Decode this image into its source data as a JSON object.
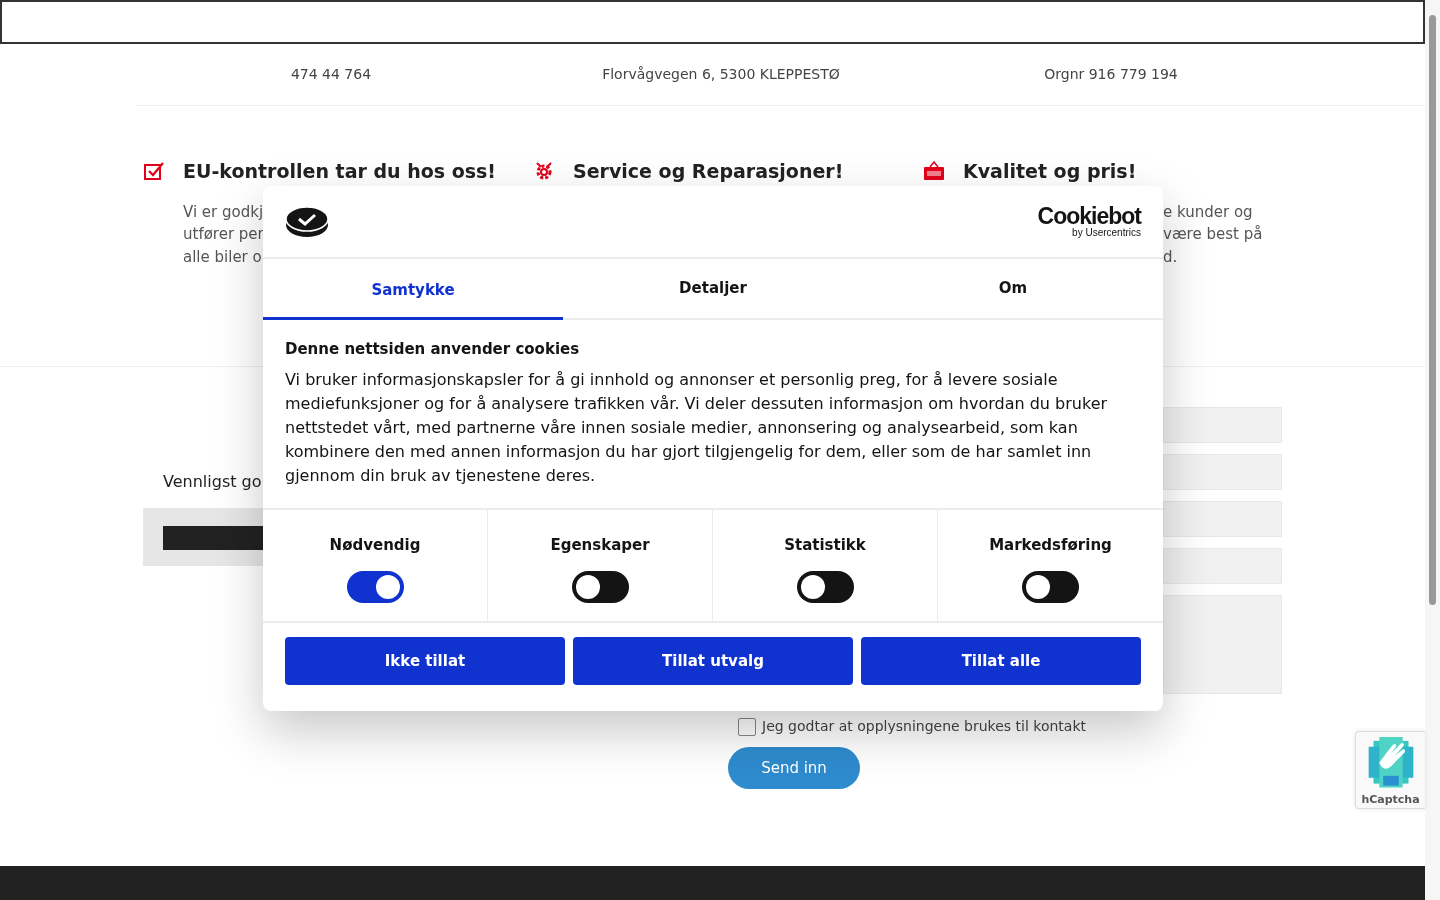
{
  "contact_bar": [
    "474 44 764",
    "Florvågvegen 6, 5300 KLEPPESTØ",
    "Orgnr 916 779 194"
  ],
  "features": [
    {
      "heading": "EU-kontrollen tar du hos oss!",
      "lines": [
        "Vi er godkj",
        "utfører per",
        "alle biler o"
      ]
    },
    {
      "heading": "Service og Reparasjoner!"
    },
    {
      "heading": "Kvalitet og pris!",
      "lines": [
        "e kunder og",
        "være best på",
        "d."
      ]
    }
  ],
  "contact": {
    "intro": "Vennligst go",
    "fields": [
      {
        "kind": "text"
      },
      {
        "kind": "text"
      },
      {
        "kind": "text"
      },
      {
        "kind": "text"
      },
      {
        "kind": "textarea"
      }
    ],
    "consent": {
      "label": "Jeg godtar at opplysningene brukes til kontakt",
      "checked": false
    },
    "submit": "Send inn"
  },
  "captcha": {
    "label": "hCaptcha"
  },
  "dialog": {
    "brand": {
      "name": "Cookiebot",
      "sub": "by Usercentrics"
    },
    "tabs": [
      {
        "label": "Samtykke",
        "selected": true
      },
      {
        "label": "Detaljer",
        "selected": false
      },
      {
        "label": "Om",
        "selected": false
      }
    ],
    "heading": "Denne nettsiden anvender cookies",
    "body": "Vi bruker informasjonskapsler for å gi innhold og annonser et personlig preg, for å levere sosiale mediefunksjoner og for å analysere trafikken vår. Vi deler dessuten informasjon om hvordan du bruker nettstedet vårt, med partnerne våre innen sosiale medier, annonsering og analysearbeid, som kan kombinere den med annen informasjon du har gjort tilgjengelig for dem, eller som de har samlet inn gjennom din bruk av tjenestene deres.",
    "categories": [
      {
        "label": "Nødvendig",
        "on": true
      },
      {
        "label": "Egenskaper",
        "on": false
      },
      {
        "label": "Statistikk",
        "on": false
      },
      {
        "label": "Markedsføring",
        "on": false
      }
    ],
    "buttons": [
      "Ikke tillat",
      "Tillat utvalg",
      "Tillat alle"
    ]
  }
}
